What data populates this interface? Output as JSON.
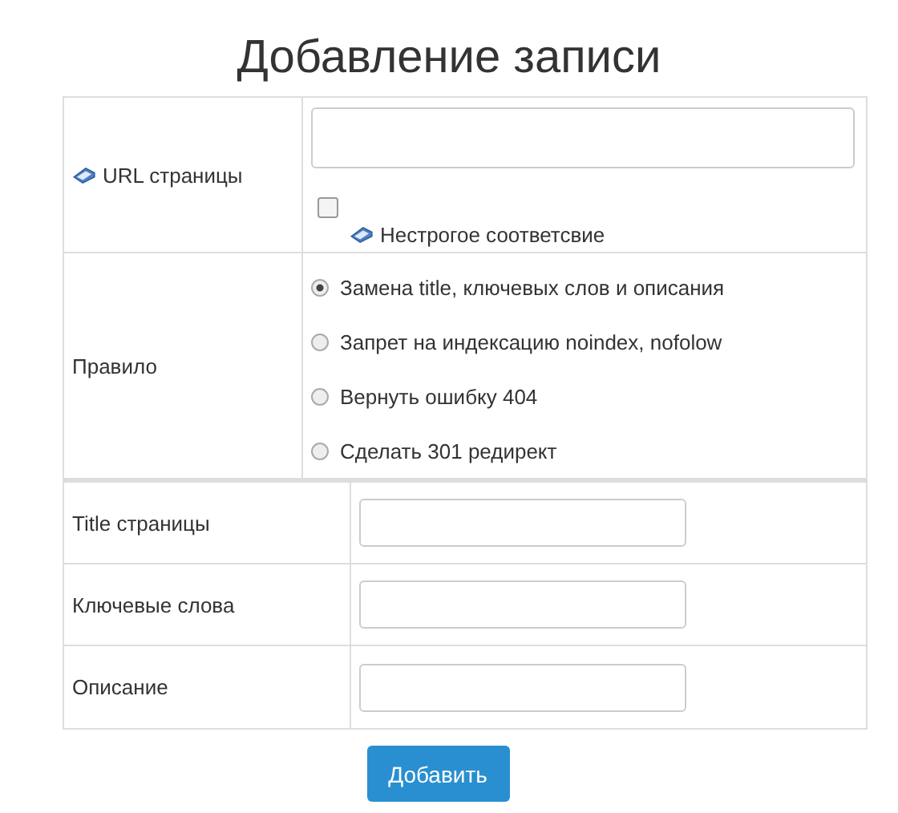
{
  "title": "Добавление записи",
  "url_field": {
    "label": "URL страницы"
  },
  "loose_match": {
    "label": "Нестрогое соответсвие",
    "checked": false
  },
  "rule": {
    "label": "Правило",
    "options": [
      {
        "label": "Замена title, ключевых слов и описания",
        "selected": true
      },
      {
        "label": "Запрет на индексацию noindex, nofolow",
        "selected": false
      },
      {
        "label": "Вернуть ошибку 404",
        "selected": false
      },
      {
        "label": "Сделать 301 редирект",
        "selected": false
      }
    ]
  },
  "fields": [
    {
      "label": "Title страницы"
    },
    {
      "label": "Ключевые слова"
    },
    {
      "label": "Описание"
    }
  ],
  "button": "Добавить"
}
